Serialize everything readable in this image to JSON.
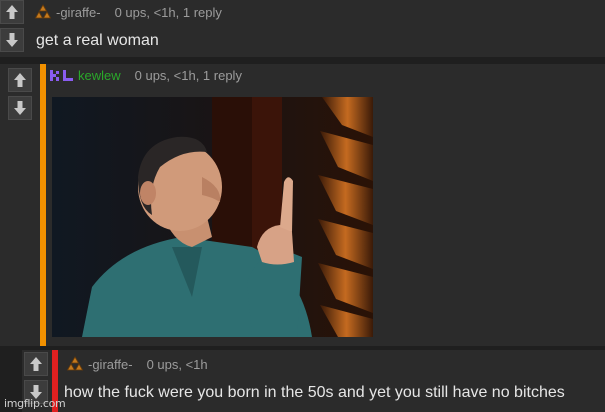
{
  "comments": [
    {
      "username": "-giraffe-",
      "meta": "0 ups, <1h, 1 reply",
      "text": "get a real woman",
      "user_icon": "triforce-icon"
    },
    {
      "username": "kewlew",
      "meta": "0 ups, <1h, 1 reply",
      "user_icon": "kl-pixel-icon",
      "accent_color": "#f29100",
      "username_color": "#2aa82a",
      "image": "man-pointing-up-gif"
    },
    {
      "username": "-giraffe-",
      "meta": "0 ups, <1h",
      "text": "how the fuck were you born in the 50s and yet you still have no bitches",
      "user_icon": "triforce-icon",
      "accent_color": "#e02020"
    }
  ],
  "watermark": "imgflip.com"
}
